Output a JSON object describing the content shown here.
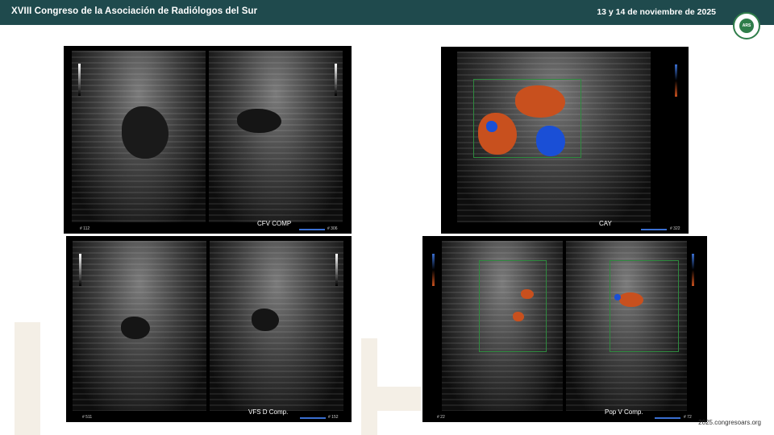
{
  "header": {
    "title": "XVIII Congreso de la Asociación de Radiólogos del Sur",
    "date": "13 y 14 de noviembre de 2025",
    "logo_text": "ARS"
  },
  "panels": [
    {
      "caption": "CFV COMP",
      "left_num": "# 112",
      "right_num": "# 306"
    },
    {
      "caption": "CAY",
      "right_num": "# 322"
    },
    {
      "caption": "VFS D Comp.",
      "left_num": "# 511",
      "right_num": "# 152"
    },
    {
      "caption": "Pop V Comp.",
      "left_num": "# 22",
      "right_num": "# 72"
    }
  ],
  "footer": {
    "url": "2025.congresoars.org"
  },
  "colors": {
    "header_bg": "#1f4a4d",
    "doppler_red": "#c8501e",
    "doppler_blue": "#1a4fd6"
  }
}
